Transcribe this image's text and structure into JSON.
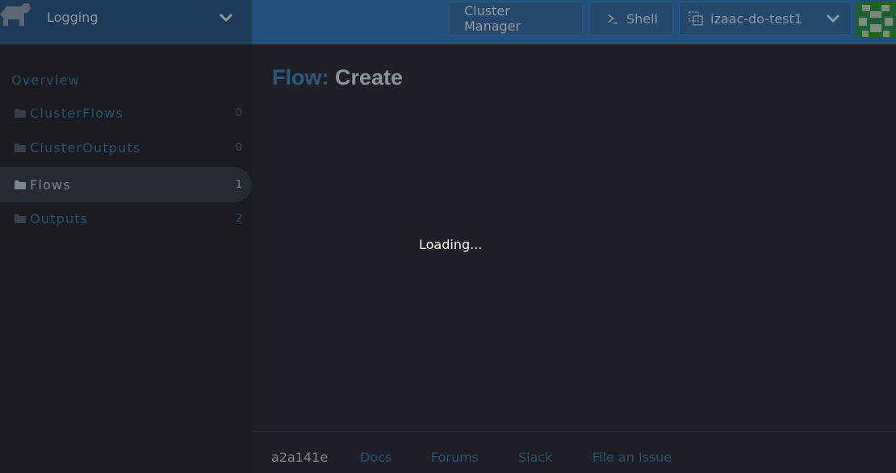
{
  "header": {
    "product_name": "Logging",
    "cluster_manager_label": "Cluster Manager",
    "shell_label": "Shell",
    "cluster_name": "izaac-do-test1"
  },
  "sidebar": {
    "overview_label": "Overview",
    "items": [
      {
        "label": "ClusterFlows",
        "count": "0",
        "active": false
      },
      {
        "label": "ClusterOutputs",
        "count": "0",
        "active": false
      },
      {
        "label": "Flows",
        "count": "1",
        "active": true
      },
      {
        "label": "Outputs",
        "count": "2",
        "active": false
      }
    ]
  },
  "main": {
    "title_type": "Flow:",
    "title_mode": "Create",
    "loading_text": "Loading..."
  },
  "footer": {
    "version": "a2a141e",
    "links": [
      "Docs",
      "Forums",
      "Slack",
      "File an Issue"
    ]
  },
  "colors": {
    "header_left_bg": "#1c3c57",
    "header_right_bg": "#23507a",
    "sidebar_bg": "#1b1c21",
    "main_bg": "#1f2027",
    "accent_link": "#2c4f6c",
    "avatar_green": "#1f5f33"
  }
}
